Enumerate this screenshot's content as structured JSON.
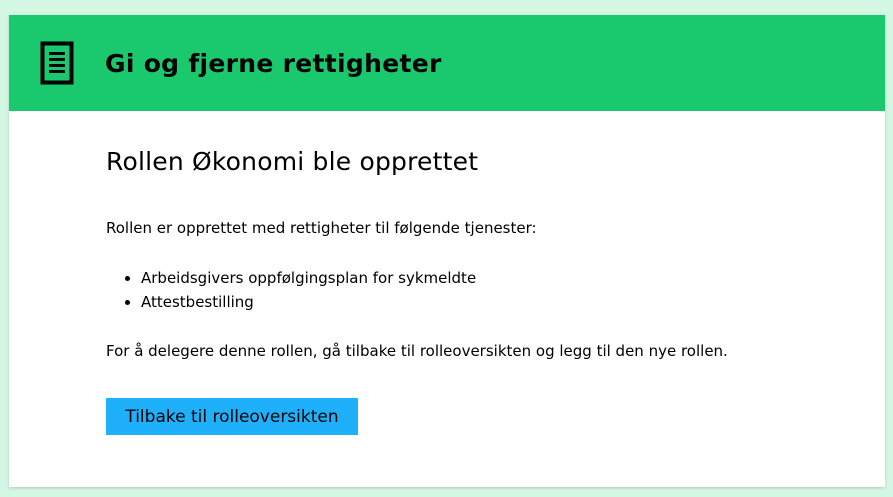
{
  "header": {
    "title": "Gi og fjerne rettigheter",
    "icon": "document-icon"
  },
  "main": {
    "heading": "Rollen Økonomi ble opprettet",
    "intro": "Rollen er opprettet med rettigheter til følgende tjenester:",
    "services": [
      "Arbeidsgivers oppfølgingsplan for sykmeldte",
      "Attestbestilling"
    ],
    "note": "For å delegere denne rollen, gå tilbake til rolleoversikten og legg til den nye rollen.",
    "back_button_label": "Tilbake til rolleoversikten"
  },
  "colors": {
    "page_background": "#d4f7e3",
    "header_background": "#1ac86e",
    "button_background": "#1eb0fb"
  }
}
